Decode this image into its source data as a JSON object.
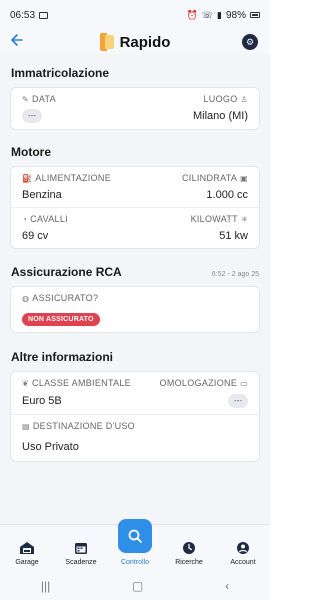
{
  "status_bar": {
    "time": "06:53",
    "battery": "98%"
  },
  "header": {
    "app_name": "Rapido"
  },
  "sections": {
    "immatricolazione": {
      "title": "Immatricolazione",
      "data_label": "DATA",
      "data_value": "---",
      "luogo_label": "LUOGO",
      "luogo_value": "Milano (MI)"
    },
    "motore": {
      "title": "Motore",
      "alimentazione_label": "ALIMENTAZIONE",
      "alimentazione_value": "Benzina",
      "cilindrata_label": "CILINDRATA",
      "cilindrata_value": "1.000 cc",
      "cavalli_label": "CAVALLI",
      "cavalli_value": "69 cv",
      "kilowatt_label": "KILOWATT",
      "kilowatt_value": "51 kw"
    },
    "assicurazione": {
      "title": "Assicurazione RCA",
      "timestamp": "6:52 - 2 ago 25",
      "assicurato_label": "ASSICURATO?",
      "assicurato_badge": "NON ASSICURATO"
    },
    "altre": {
      "title": "Altre informazioni",
      "classe_label": "CLASSE AMBIENTALE",
      "classe_value": "Euro 5B",
      "omologazione_label": "OMOLOGAZIONE",
      "omologazione_value": "---",
      "destinazione_label": "DESTINAZIONE D'USO",
      "destinazione_value": "Uso Privato"
    }
  },
  "bottom_nav": [
    {
      "label": "Garage",
      "icon": "garage-icon"
    },
    {
      "label": "Scadenze",
      "icon": "calendar-icon"
    },
    {
      "label": "Controllo",
      "icon": "search-icon"
    },
    {
      "label": "Ricerche",
      "icon": "history-icon"
    },
    {
      "label": "Account",
      "icon": "account-icon"
    }
  ],
  "colors": {
    "accent": "#2f8fe8",
    "danger": "#e0424f",
    "header_bg": "#f7f8fb"
  }
}
